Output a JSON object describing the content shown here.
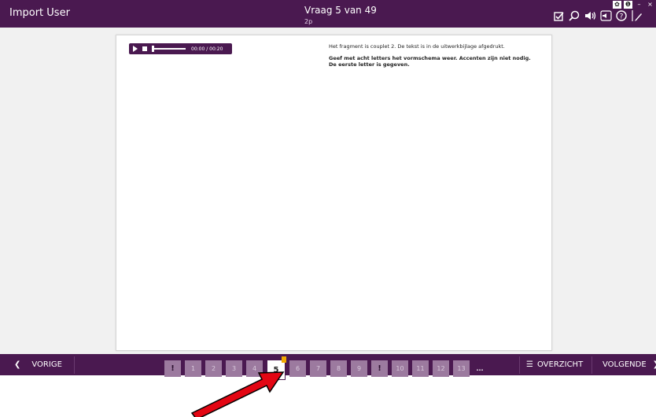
{
  "header": {
    "user": "Import User",
    "question_title": "Vraag 5 van 49",
    "points": "2p",
    "icons": [
      "checkbox-icon",
      "search-icon",
      "speaker-icon",
      "settings-icon",
      "help-icon",
      "pen-icon"
    ],
    "window_controls": [
      "gear-icon",
      "info-icon",
      "minimize-icon",
      "close-icon"
    ]
  },
  "player": {
    "time": "00:00 / 00:20",
    "progress_fraction": 0.0
  },
  "question": {
    "intro": "Het fragment is couplet 2. De tekst is in de uitwerkbijlage afgedrukt.",
    "instruction": "Geef met acht letters het vormschema weer. Accenten zijn niet nodig. De eerste letter is gegeven."
  },
  "nav": {
    "prev_label": "VORIGE",
    "overview_label": "OVERZICHT",
    "next_label": "VOLGENDE",
    "pages": [
      "!",
      "1",
      "2",
      "3",
      "4",
      "5",
      "6",
      "7",
      "8",
      "9",
      "!",
      "10",
      "11",
      "12",
      "13",
      "..."
    ],
    "current_page": "5"
  },
  "colors": {
    "brand": "#4a1950",
    "page_chip": "#9c7a9f",
    "flag": "#f2a900",
    "arrow": "#e30613"
  }
}
